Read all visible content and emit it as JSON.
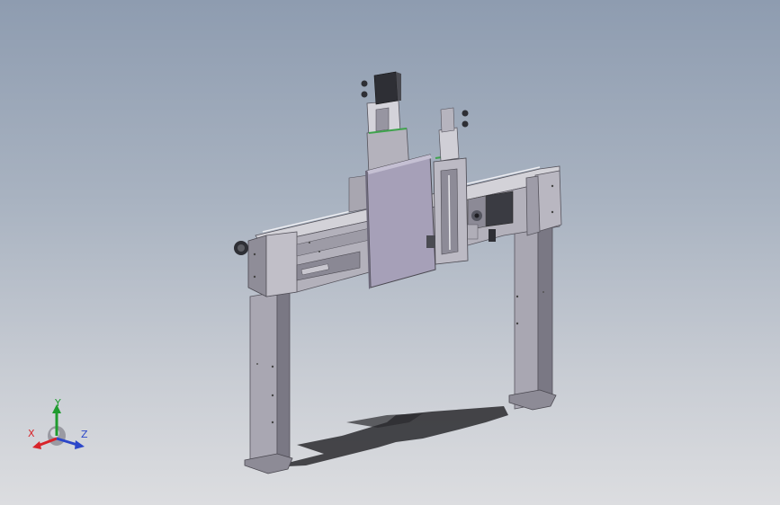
{
  "viewport": {
    "background_top": "#8e9cb0",
    "background_bottom": "#dcdde0"
  },
  "model": {
    "steel_light": "#c9c8cf",
    "steel_mid": "#a9a7b2",
    "steel_dark": "#7a7884",
    "plate_color": "#a6a0b8",
    "motor_color": "#2e2f35",
    "accent_green": "#3fa34d",
    "shadow_color": "#2a2a2e"
  },
  "triad": {
    "x_label": "X",
    "y_label": "Y",
    "z_label": "Z",
    "x_color": "#d8242a",
    "y_color": "#1f9b2e",
    "z_color": "#2c47c9"
  }
}
